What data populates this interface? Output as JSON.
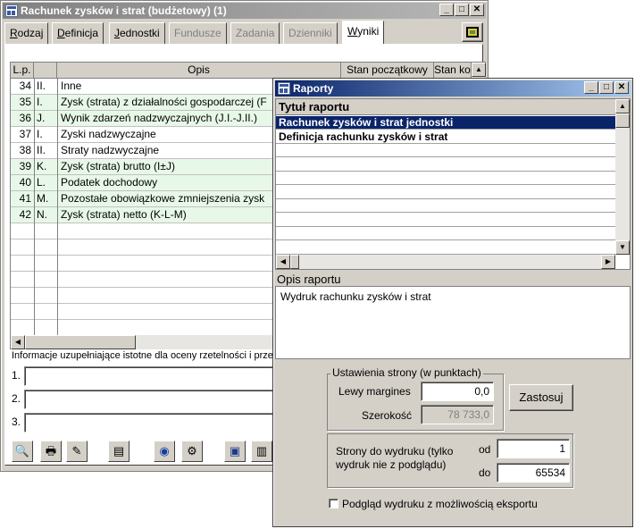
{
  "main": {
    "title": "Rachunek zysków i strat (budżetowy) (1)",
    "tabs": [
      {
        "label": "Rodzaj",
        "u": "R",
        "rest": "odzaj"
      },
      {
        "label": "Definicja",
        "u": "D",
        "rest": "efinicja"
      },
      {
        "label": "Jednostki",
        "u": "J",
        "rest": "ednostki"
      },
      {
        "label": "Fundusze"
      },
      {
        "label": "Zadania"
      },
      {
        "label": "Dzienniki"
      },
      {
        "label": "Wyniki",
        "u": "W",
        "rest": "yniki"
      }
    ],
    "columns": {
      "lp": "L.p.",
      "opis": "Opis",
      "stan": "Stan początkowy",
      "stan_ko": "Stan ko"
    },
    "rows": [
      {
        "lp": "34",
        "sym": "II.",
        "opis": "Inne",
        "green": false
      },
      {
        "lp": "35",
        "sym": "I.",
        "opis": "Zysk (strata) z działalności gospodarczej (F",
        "green": true
      },
      {
        "lp": "36",
        "sym": "J.",
        "opis": "Wynik zdarzeń nadzwyczajnych (J.I.-J.II.)",
        "green": true
      },
      {
        "lp": "37",
        "sym": "I.",
        "opis": "Zyski nadzwyczajne",
        "green": false
      },
      {
        "lp": "38",
        "sym": "II.",
        "opis": "Straty nadzwyczajne",
        "green": false
      },
      {
        "lp": "39",
        "sym": "K.",
        "opis": "Zysk (strata) brutto (I±J)",
        "green": true
      },
      {
        "lp": "40",
        "sym": "L.",
        "opis": "Podatek dochodowy",
        "green": true
      },
      {
        "lp": "41",
        "sym": "M.",
        "opis": "Pozostałe obowiązkowe zmniejszenia zysk",
        "green": true
      },
      {
        "lp": "42",
        "sym": "N.",
        "opis": "Zysk (strata) netto (K-L-M)",
        "green": true
      }
    ],
    "info_label": "Informacje uzupełniające istotne dla oceny rzetelności i przejr",
    "info_rows": [
      "1.",
      "2.",
      "3."
    ]
  },
  "reports": {
    "title": "Raporty",
    "header": "Tytuł raportu",
    "items": [
      "Rachunek zysków i strat jednostki",
      "Definicja rachunku zysków i strat"
    ],
    "desc_label": "Opis raportu",
    "desc_text": "Wydruk rachunku zysków i strat",
    "page_group": "Ustawienia strony (w punktach)",
    "left_margin_label": "Lewy margines",
    "left_margin_value": "0,0",
    "width_label": "Szerokość",
    "width_value": "78 733,0",
    "apply": "Zastosuj",
    "pages_label": "Strony do wydruku (tylko wydruk nie z podglądu)",
    "from_label": "od",
    "from_value": "1",
    "to_label": "do",
    "to_value": "65534",
    "preview_label": "Podgląd wydruku z możliwością eksportu"
  },
  "colors": {
    "row_green": "#e8f8e8",
    "selection": "#0a246a"
  }
}
